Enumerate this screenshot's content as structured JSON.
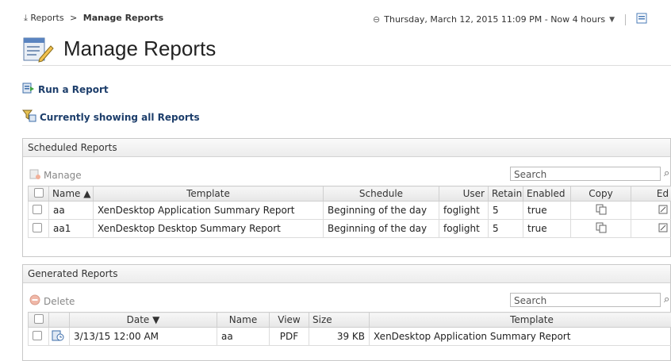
{
  "breadcrumb": {
    "root": "Reports",
    "separator": ">",
    "current": "Manage Reports"
  },
  "timebar": {
    "text": "Thursday, March 12, 2015 11:09 PM - Now 4 hours"
  },
  "page": {
    "title": "Manage Reports"
  },
  "links": {
    "run_report": "Run a Report",
    "showing_all": "Currently showing all Reports"
  },
  "scheduled": {
    "title": "Scheduled Reports",
    "manage_label": "Manage",
    "search_placeholder": "Search",
    "columns": [
      "Name ▲",
      "Template",
      "Schedule",
      "User",
      "Retain",
      "Enabled",
      "Copy",
      "Ed"
    ],
    "rows": [
      {
        "name": "aa",
        "template": "XenDesktop Application Summary Report",
        "schedule": "Beginning of the day",
        "user": "foglight",
        "retain": "5",
        "enabled": "true"
      },
      {
        "name": "aa1",
        "template": "XenDesktop Desktop Summary Report",
        "schedule": "Beginning of the day",
        "user": "foglight",
        "retain": "5",
        "enabled": "true"
      }
    ]
  },
  "generated": {
    "title": "Generated Reports",
    "delete_label": "Delete",
    "search_placeholder": "Search",
    "columns": [
      "Date ▼",
      "Name",
      "View",
      "Size",
      "Template"
    ],
    "rows": [
      {
        "date": "3/13/15 12:00 AM",
        "name": "aa",
        "view": "PDF",
        "size": "39 KB",
        "template": "XenDesktop Application Summary Report"
      }
    ]
  },
  "colors": {
    "link": "#1d3e6b",
    "header_bg": "#ececec",
    "border": "#c8c8c8"
  }
}
